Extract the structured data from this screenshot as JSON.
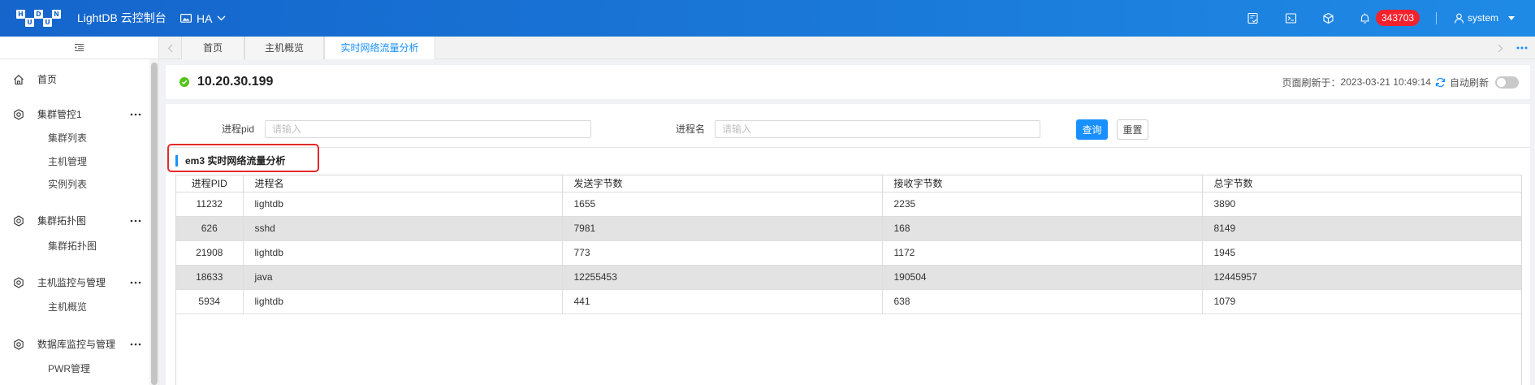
{
  "header": {
    "logo_letters": [
      "H",
      "U",
      "D",
      "U",
      "N"
    ],
    "app_title": "LightDB 云控制台",
    "cluster_selector": {
      "icon": "desktop-icon",
      "value": "HA",
      "dropdown_icon": "chevron-down-icon"
    },
    "toolbar_icons": [
      "report-icon",
      "terminal-icon",
      "cube-icon",
      "bell-icon"
    ],
    "notification_count": "343703",
    "user": {
      "icon": "user-icon",
      "name": "system",
      "dropdown_icon": "caret-down-icon"
    }
  },
  "sidebar": {
    "collapse_icon": "menu-fold-icon",
    "items": [
      {
        "label": "首页",
        "icon": "home-icon"
      },
      {
        "label": "集群管控1",
        "icon": "setting-icon",
        "children": [
          "集群列表",
          "主机管理",
          "实例列表"
        ]
      },
      {
        "label": "集群拓扑图",
        "icon": "setting-icon",
        "children": [
          "集群拓扑图"
        ]
      },
      {
        "label": "主机监控与管理",
        "icon": "setting-icon",
        "children": [
          "主机概览"
        ]
      },
      {
        "label": "数据库监控与管理",
        "icon": "setting-icon",
        "children": [
          "PWR管理"
        ]
      }
    ]
  },
  "tabs": [
    {
      "label": "首页",
      "active": false
    },
    {
      "label": "主机概览",
      "active": false
    },
    {
      "label": "实时网络流量分析",
      "active": true
    }
  ],
  "host": {
    "status_icon": "check-circle-icon",
    "ip": "10.20.30.199"
  },
  "refresh": {
    "label": "页面刷新于：",
    "time": "2023-03-21 10:49:14",
    "icon": "refresh-icon",
    "auto_label": "自动刷新",
    "auto_refresh_on": false
  },
  "filters": {
    "pid_label": "进程pid",
    "pid_placeholder": "请输入",
    "pid_value": "",
    "name_label": "进程名",
    "name_placeholder": "请输入",
    "name_value": "",
    "query_button": "查询",
    "reset_button": "重置"
  },
  "section": {
    "title": "em3 实时网络流量分析"
  },
  "table": {
    "columns": [
      "进程PID",
      "进程名",
      "发送字节数",
      "接收字节数",
      "总字节数"
    ],
    "rows": [
      {
        "pid": "11232",
        "pid_link": true,
        "name": "lightdb",
        "sent": "1655",
        "received": "2235",
        "total": "3890"
      },
      {
        "pid": "626",
        "pid_link": false,
        "name": "sshd",
        "sent": "7981",
        "received": "168",
        "total": "8149"
      },
      {
        "pid": "21908",
        "pid_link": true,
        "name": "lightdb",
        "sent": "773",
        "received": "1172",
        "total": "1945"
      },
      {
        "pid": "18633",
        "pid_link": false,
        "name": "java",
        "sent": "12255453",
        "received": "190504",
        "total": "12445957"
      },
      {
        "pid": "5934",
        "pid_link": true,
        "name": "lightdb",
        "sent": "441",
        "received": "638",
        "total": "1079"
      }
    ]
  },
  "colors": {
    "header_start": "#1565cc",
    "header_end": "#1f8ae6",
    "primary": "#1890ff",
    "danger": "#f5222d",
    "success": "#52c41a",
    "highlight_border": "#e32a2a",
    "row_stripe": "#e3e3e3"
  }
}
